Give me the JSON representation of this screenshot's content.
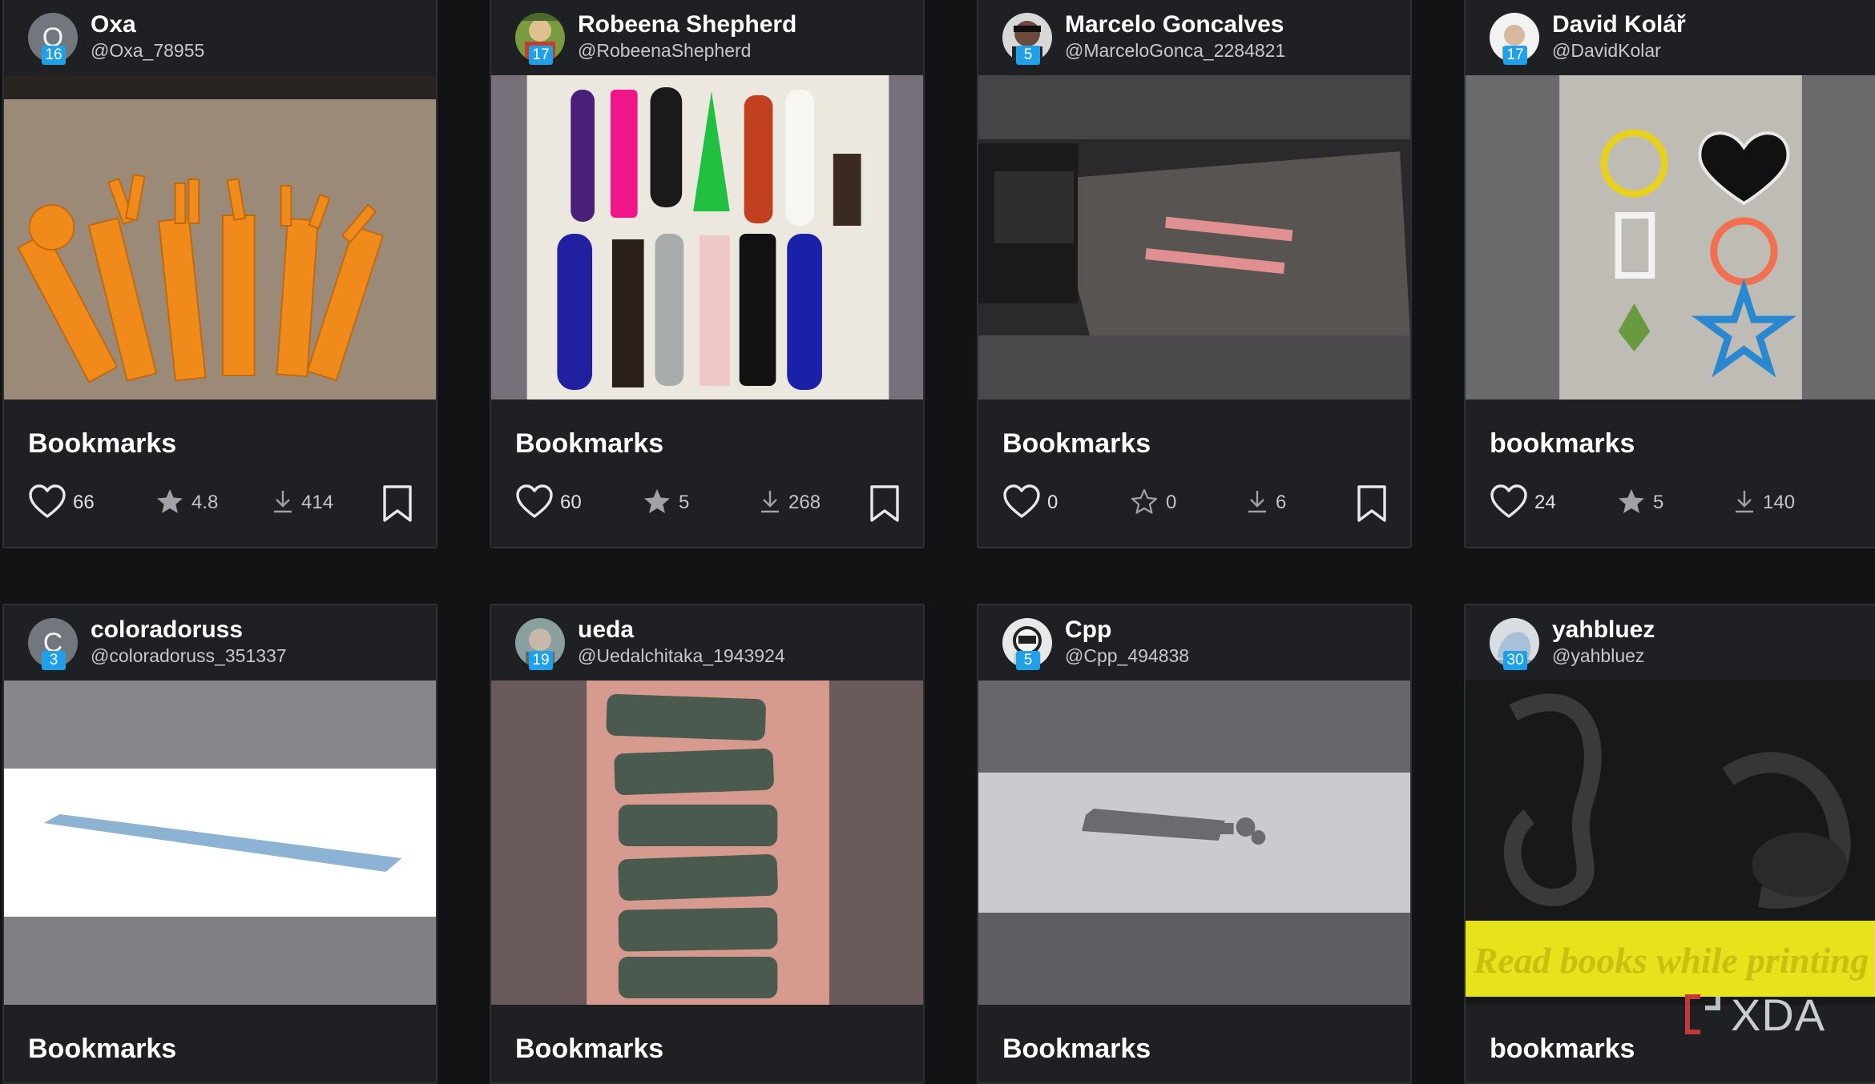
{
  "watermark": "XDA",
  "cards": [
    {
      "name": "Oxa",
      "handle": "@Oxa_78955",
      "level": "16",
      "avatar_initial": "O",
      "title": "Bookmarks",
      "likes": "66",
      "rating": "4.8",
      "rating_filled": true,
      "downloads": "414"
    },
    {
      "name": "Robeena Shepherd",
      "handle": "@RobeenaShepherd",
      "level": "17",
      "avatar_initial": "",
      "title": "Bookmarks",
      "likes": "60",
      "rating": "5",
      "rating_filled": true,
      "downloads": "268"
    },
    {
      "name": "Marcelo Goncalves",
      "handle": "@MarceloGonca_2284821",
      "level": "5",
      "avatar_initial": "",
      "title": "Bookmarks",
      "likes": "0",
      "rating": "0",
      "rating_filled": false,
      "downloads": "6"
    },
    {
      "name": "David Kolář",
      "handle": "@DavidKolar",
      "level": "17",
      "avatar_initial": "",
      "title": "bookmarks",
      "likes": "24",
      "rating": "5",
      "rating_filled": true,
      "downloads": "140"
    },
    {
      "name": "coloradoruss",
      "handle": "@coloradoruss_351337",
      "level": "3",
      "avatar_initial": "C",
      "title": "Bookmarks"
    },
    {
      "name": "ueda",
      "handle": "@Uedalchitaka_1943924",
      "level": "19",
      "avatar_initial": "",
      "title": "Bookmarks"
    },
    {
      "name": "Cpp",
      "handle": "@Cpp_494838",
      "level": "5",
      "avatar_initial": "",
      "title": "Bookmarks"
    },
    {
      "name": "yahbluez",
      "handle": "@yahbluez",
      "level": "30",
      "avatar_initial": "",
      "title": "bookmarks",
      "image_text": "Read books while printing"
    }
  ],
  "icons": {
    "like": "heart-icon",
    "rating": "star-icon",
    "downloads": "download-icon",
    "save": "bookmark-icon"
  },
  "colors": {
    "page_bg": "#121315",
    "card_bg": "#1f2023",
    "level_badge": "#1fa0e8",
    "stat_text": "#c3c5c9"
  }
}
